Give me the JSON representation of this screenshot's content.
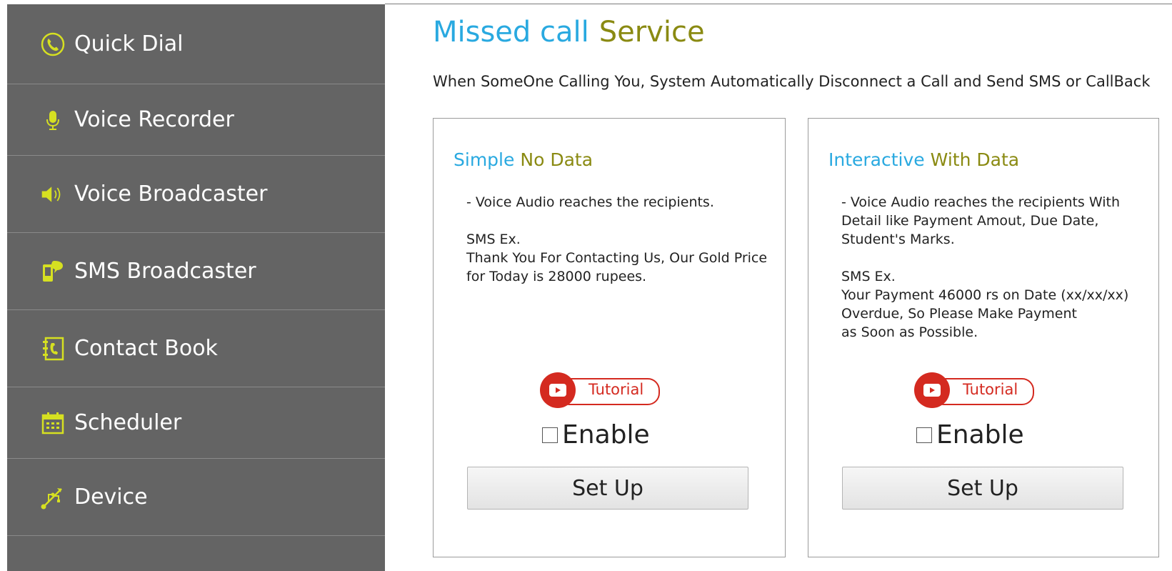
{
  "sidebar": {
    "items": [
      {
        "label": "Quick Dial",
        "icon": "phone-icon"
      },
      {
        "label": "Voice Recorder",
        "icon": "microphone-icon"
      },
      {
        "label": "Voice Broadcaster",
        "icon": "speaker-icon"
      },
      {
        "label": "SMS Broadcaster",
        "icon": "sms-icon"
      },
      {
        "label": "Contact Book",
        "icon": "contact-book-icon"
      },
      {
        "label": "Scheduler",
        "icon": "calendar-icon"
      },
      {
        "label": "Device",
        "icon": "usb-icon"
      }
    ]
  },
  "main": {
    "title_part1": "Missed call",
    "title_part2": "Service",
    "description": "When SomeOne Calling You, System Automatically Disconnect a Call and Send SMS or CallBack",
    "cards": [
      {
        "title_part1": "Simple",
        "title_part2": "No Data",
        "body": "- Voice Audio reaches the recipients.\n\nSMS Ex.\nThank You For Contacting Us, Our Gold Price\nfor Today is 28000 rupees.",
        "tutorial_label": "Tutorial",
        "enable_label": "Enable",
        "setup_label": "Set Up"
      },
      {
        "title_part1": "Interactive",
        "title_part2": "With Data",
        "body": "- Voice Audio reaches the recipients With\nDetail like Payment Amout, Due Date,\nStudent's Marks.\n\nSMS Ex.\nYour Payment 46000 rs on Date (xx/xx/xx)\nOverdue, So Please Make Payment\nas Soon as Possible.",
        "tutorial_label": "Tutorial",
        "enable_label": "Enable",
        "setup_label": "Set Up"
      }
    ]
  },
  "colors": {
    "sidebar_bg": "#646464",
    "icon_accent": "#d6e021",
    "title_blue": "#29a9e0",
    "title_olive": "#8a8a12",
    "youtube_red": "#d42a20"
  }
}
